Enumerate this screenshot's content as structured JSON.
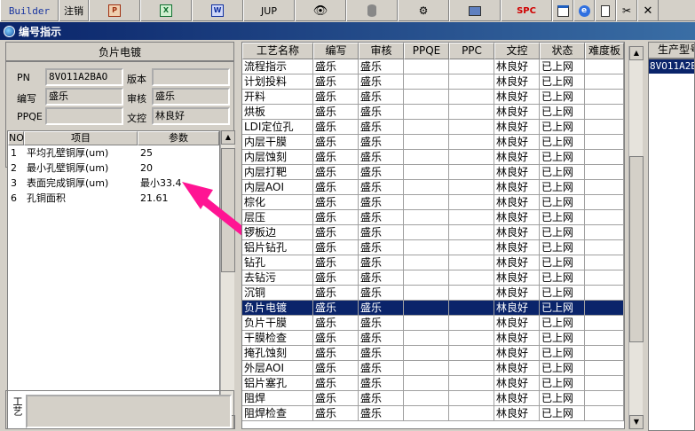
{
  "toolbar": {
    "builder": "Builder",
    "logout": "注销",
    "jup": "JUP",
    "spc": "SPC"
  },
  "window": {
    "title": "编号指示"
  },
  "left": {
    "header": "负片电镀",
    "form": {
      "pn_label": "PN",
      "pn_value": "8VO11A2BAO",
      "version_label": "版本",
      "version_value": "",
      "writer_label": "编写",
      "writer_value": "盛乐",
      "review_label": "审核",
      "review_value": "盛乐",
      "ppqe_label": "PPQE",
      "ppqe_value": "",
      "docctrl_label": "文控",
      "docctrl_value": "林良好"
    },
    "params": {
      "headers": [
        "NO",
        "项目",
        "参数"
      ],
      "rows": [
        [
          "1",
          "平均孔壁铜厚(um)",
          "25"
        ],
        [
          "2",
          "最小孔壁铜厚(um)",
          "20"
        ],
        [
          "3",
          "表面完成铜厚(um)",
          "最小33.4"
        ],
        [
          "6",
          "孔铜面积",
          "21.61"
        ]
      ]
    },
    "bottom_label": "工艺"
  },
  "grid": {
    "headers": [
      "工艺名称",
      "编写",
      "审核",
      "PPQE",
      "PPC",
      "文控",
      "状态",
      "难度板"
    ],
    "rows": [
      [
        "流程指示",
        "盛乐",
        "盛乐",
        "",
        "",
        "林良好",
        "已上网",
        ""
      ],
      [
        "计划投料",
        "盛乐",
        "盛乐",
        "",
        "",
        "林良好",
        "已上网",
        ""
      ],
      [
        "开料",
        "盛乐",
        "盛乐",
        "",
        "",
        "林良好",
        "已上网",
        ""
      ],
      [
        "烘板",
        "盛乐",
        "盛乐",
        "",
        "",
        "林良好",
        "已上网",
        ""
      ],
      [
        "LDI定位孔",
        "盛乐",
        "盛乐",
        "",
        "",
        "林良好",
        "已上网",
        ""
      ],
      [
        "内层干膜",
        "盛乐",
        "盛乐",
        "",
        "",
        "林良好",
        "已上网",
        ""
      ],
      [
        "内层蚀刻",
        "盛乐",
        "盛乐",
        "",
        "",
        "林良好",
        "已上网",
        ""
      ],
      [
        "内层打靶",
        "盛乐",
        "盛乐",
        "",
        "",
        "林良好",
        "已上网",
        ""
      ],
      [
        "内层AOI",
        "盛乐",
        "盛乐",
        "",
        "",
        "林良好",
        "已上网",
        ""
      ],
      [
        "棕化",
        "盛乐",
        "盛乐",
        "",
        "",
        "林良好",
        "已上网",
        ""
      ],
      [
        "层压",
        "盛乐",
        "盛乐",
        "",
        "",
        "林良好",
        "已上网",
        ""
      ],
      [
        "锣板边",
        "盛乐",
        "盛乐",
        "",
        "",
        "林良好",
        "已上网",
        ""
      ],
      [
        "铝片钻孔",
        "盛乐",
        "盛乐",
        "",
        "",
        "林良好",
        "已上网",
        ""
      ],
      [
        "钻孔",
        "盛乐",
        "盛乐",
        "",
        "",
        "林良好",
        "已上网",
        ""
      ],
      [
        "去钻污",
        "盛乐",
        "盛乐",
        "",
        "",
        "林良好",
        "已上网",
        ""
      ],
      [
        "沉铜",
        "盛乐",
        "盛乐",
        "",
        "",
        "林良好",
        "已上网",
        ""
      ],
      [
        "负片电镀",
        "盛乐",
        "盛乐",
        "",
        "",
        "林良好",
        "已上网",
        ""
      ],
      [
        "负片干膜",
        "盛乐",
        "盛乐",
        "",
        "",
        "林良好",
        "已上网",
        ""
      ],
      [
        "干膜检查",
        "盛乐",
        "盛乐",
        "",
        "",
        "林良好",
        "已上网",
        ""
      ],
      [
        "掩孔蚀刻",
        "盛乐",
        "盛乐",
        "",
        "",
        "林良好",
        "已上网",
        ""
      ],
      [
        "外层AOI",
        "盛乐",
        "盛乐",
        "",
        "",
        "林良好",
        "已上网",
        ""
      ],
      [
        "铝片塞孔",
        "盛乐",
        "盛乐",
        "",
        "",
        "林良好",
        "已上网",
        ""
      ],
      [
        "阻焊",
        "盛乐",
        "盛乐",
        "",
        "",
        "林良好",
        "已上网",
        ""
      ],
      [
        "阻焊检查",
        "盛乐",
        "盛乐",
        "",
        "",
        "林良好",
        "已上网",
        ""
      ]
    ],
    "selected_index": 16
  },
  "right": {
    "header": "生产型号",
    "item": "8VO11A2BA"
  }
}
